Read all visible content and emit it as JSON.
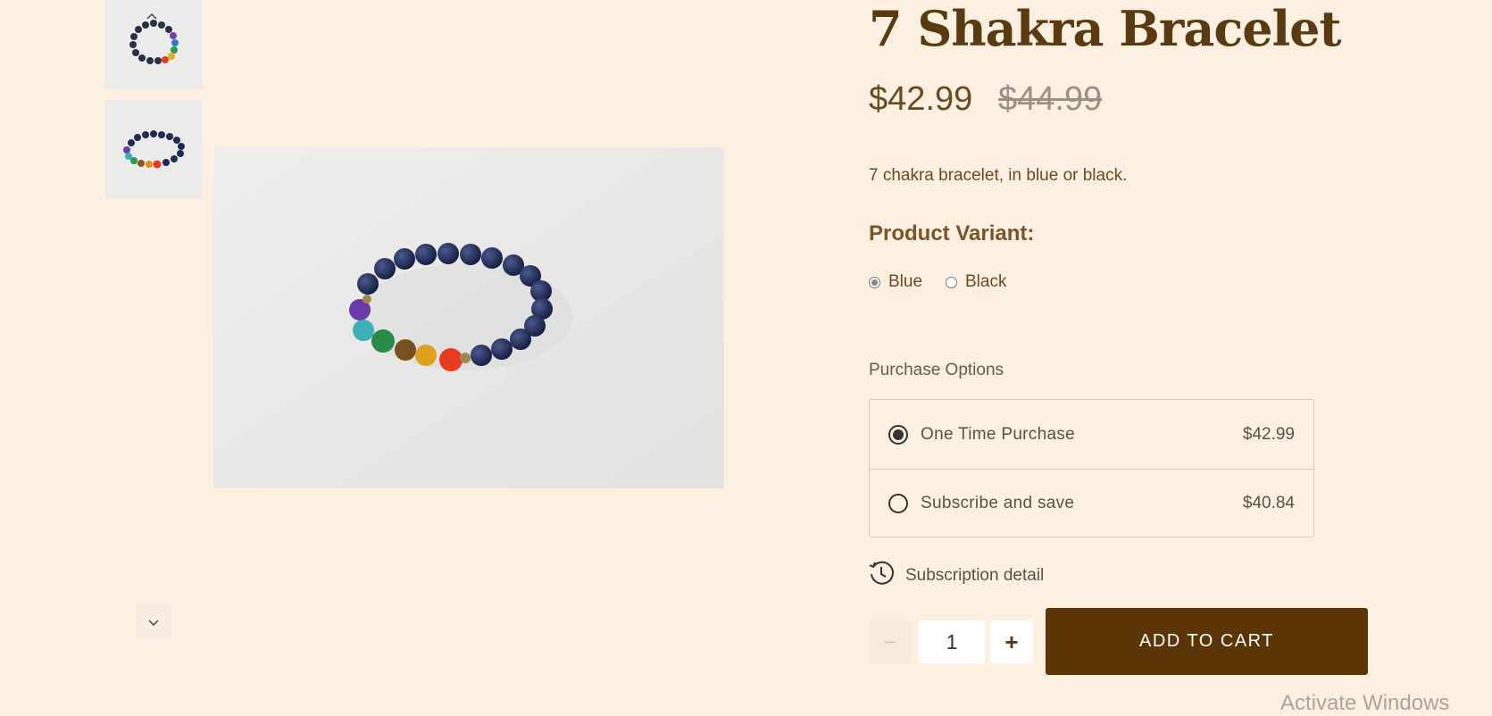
{
  "product": {
    "title": "7 Shakra Bracelet",
    "price": "$42.99",
    "compare_price": "$44.99",
    "description": "7 chakra bracelet, in blue or black."
  },
  "gallery": {
    "up_icon": "chevron-up-icon",
    "down_icon": "chevron-down-icon",
    "thumbnails": [
      "bracelet-thumb-1",
      "bracelet-thumb-2"
    ]
  },
  "variant": {
    "label": "Product Variant:",
    "options": [
      {
        "label": "Blue",
        "selected": true
      },
      {
        "label": "Black",
        "selected": false
      }
    ]
  },
  "purchase_options": {
    "label": "Purchase Options",
    "options": [
      {
        "label": "One Time Purchase",
        "price": "$42.99",
        "selected": true
      },
      {
        "label": "Subscribe and save",
        "price": "$40.84",
        "selected": false
      }
    ],
    "subscription_detail": "Subscription detail"
  },
  "cart": {
    "quantity": "1",
    "minus": "−",
    "plus": "+",
    "add_label": "ADD TO CART"
  },
  "watermark": "Activate Windows",
  "colors": {
    "background": "#fdf0e1",
    "brand": "#5b3506",
    "title": "#5a3a10"
  }
}
